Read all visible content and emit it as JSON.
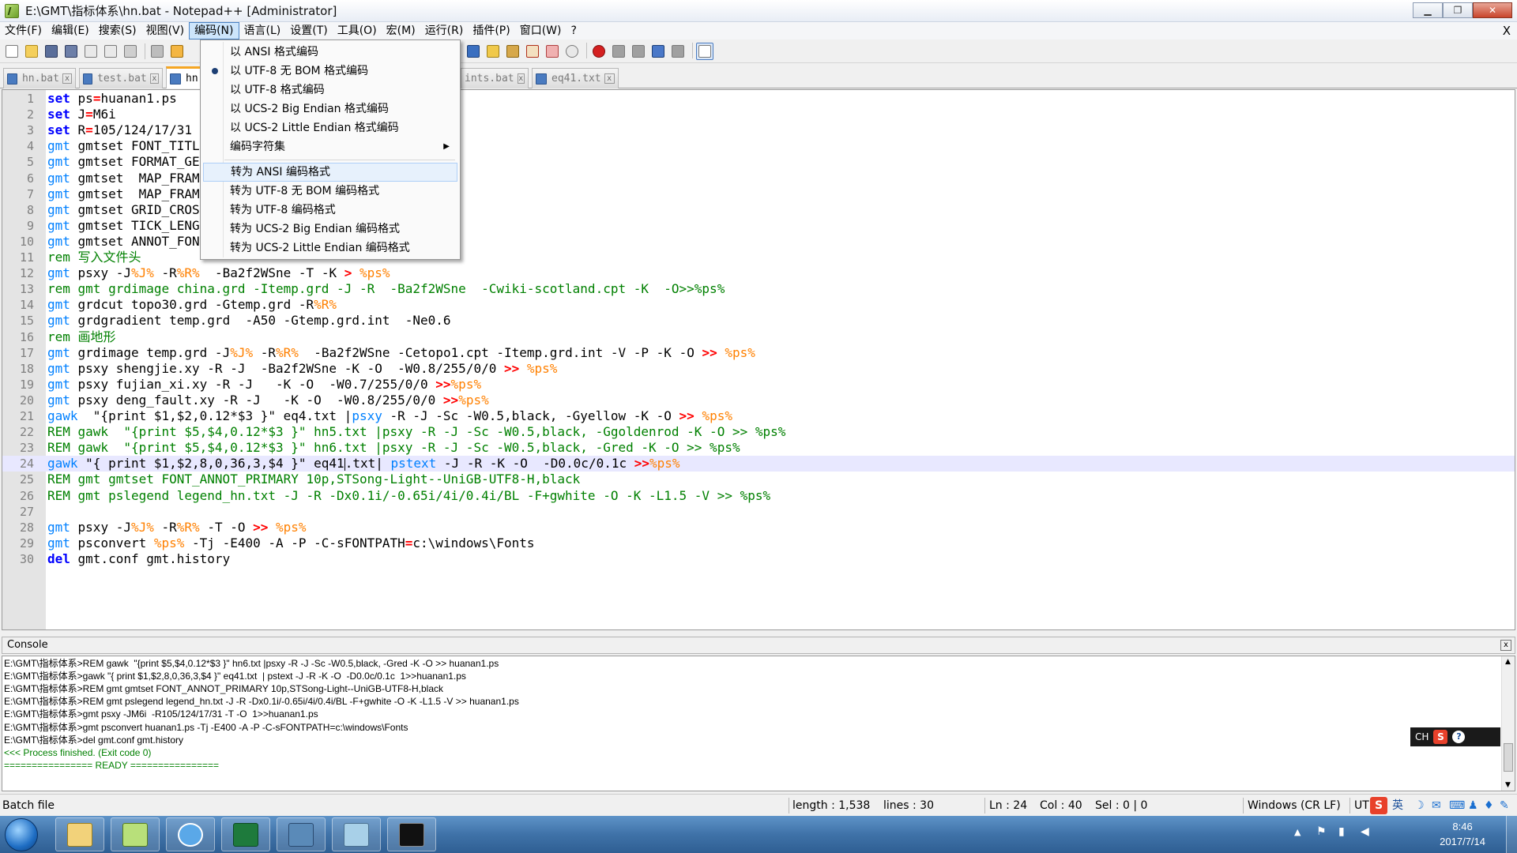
{
  "window": {
    "title": "E:\\GMT\\指标体系\\hn.bat - Notepad++ [Administrator]",
    "minimize_label": "▁",
    "restore_label": "❐",
    "close_label": "✕"
  },
  "menubar": {
    "items": [
      "文件(F)",
      "编辑(E)",
      "搜索(S)",
      "视图(V)",
      "编码(N)",
      "语言(L)",
      "设置(T)",
      "工具(O)",
      "宏(M)",
      "运行(R)",
      "插件(P)",
      "窗口(W)",
      "?"
    ],
    "active_index": 4,
    "close_label": "X"
  },
  "tabs": [
    {
      "label": "hn.bat",
      "active": false
    },
    {
      "label": "test.bat",
      "active": false
    },
    {
      "label": "hn",
      "active": true
    },
    {
      "label": "ints.bat",
      "active": false
    },
    {
      "label": "eq41.txt",
      "active": false
    }
  ],
  "encoding_menu": {
    "items": [
      {
        "label": "以 ANSI 格式编码",
        "checked": false
      },
      {
        "label": "以 UTF-8 无 BOM 格式编码",
        "checked": true
      },
      {
        "label": "以 UTF-8 格式编码",
        "checked": false
      },
      {
        "label": "以 UCS-2 Big Endian 格式编码",
        "checked": false
      },
      {
        "label": "以 UCS-2 Little Endian 格式编码",
        "checked": false
      },
      {
        "label": "编码字符集",
        "submenu": true
      },
      {
        "label": "转为 ANSI 编码格式",
        "hover": true
      },
      {
        "label": "转为 UTF-8 无 BOM 编码格式"
      },
      {
        "label": "转为 UTF-8 编码格式"
      },
      {
        "label": "转为 UCS-2 Big Endian 编码格式"
      },
      {
        "label": "转为 UCS-2 Little Endian 编码格式"
      }
    ],
    "submenu_arrow": "▶"
  },
  "editor": {
    "current_line": 24,
    "lines": [
      [
        [
          "kw",
          "set"
        ],
        [
          "plain",
          " ps"
        ],
        [
          "op",
          "="
        ],
        [
          "plain",
          "huanan1.ps"
        ]
      ],
      [
        [
          "kw",
          "set"
        ],
        [
          "plain",
          " J"
        ],
        [
          "op",
          "="
        ],
        [
          "plain",
          "M6i"
        ]
      ],
      [
        [
          "kw",
          "set"
        ],
        [
          "plain",
          " R"
        ],
        [
          "op",
          "="
        ],
        [
          "plain",
          "105/124/17/31"
        ]
      ],
      [
        [
          "fn",
          "gmt"
        ],
        [
          "plain",
          " gmtset FONT_TITLE"
        ]
      ],
      [
        [
          "fn",
          "gmt"
        ],
        [
          "plain",
          " gmtset FORMAT_GEO"
        ]
      ],
      [
        [
          "fn",
          "gmt"
        ],
        [
          "plain",
          " gmtset  MAP_FRAME"
        ]
      ],
      [
        [
          "fn",
          "gmt"
        ],
        [
          "plain",
          " gmtset  MAP_FRAME"
        ]
      ],
      [
        [
          "fn",
          "gmt"
        ],
        [
          "plain",
          " gmtset GRID_CROSS"
        ]
      ],
      [
        [
          "fn",
          "gmt"
        ],
        [
          "plain",
          " gmtset TICK_LENGTH"
        ]
      ],
      [
        [
          "fn",
          "gmt"
        ],
        [
          "plain",
          " gmtset ANNOT_FONT"
        ]
      ],
      [
        [
          "cm",
          "rem 写入文件头"
        ]
      ],
      [
        [
          "fn",
          "gmt"
        ],
        [
          "plain",
          " psxy -J"
        ],
        [
          "vr",
          "%J%"
        ],
        [
          "plain",
          " -R"
        ],
        [
          "vr",
          "%R%"
        ],
        [
          "plain",
          "  -Ba2f2WSne -T -K "
        ],
        [
          "op",
          ">"
        ],
        [
          "plain",
          " "
        ],
        [
          "vr",
          "%ps%"
        ]
      ],
      [
        [
          "cm",
          "rem gmt grdimage china.grd -Itemp.grd -J -R  -Ba2f2WSne  -Cwiki-scotland.cpt -K  -O>>%ps%"
        ]
      ],
      [
        [
          "fn",
          "gmt"
        ],
        [
          "plain",
          " grdcut topo30.grd -Gtemp.grd -R"
        ],
        [
          "vr",
          "%R%"
        ]
      ],
      [
        [
          "fn",
          "gmt"
        ],
        [
          "plain",
          " grdgradient temp.grd  -A50 -Gtemp.grd.int  -Ne0.6"
        ]
      ],
      [
        [
          "cm",
          "rem 画地形"
        ]
      ],
      [
        [
          "fn",
          "gmt"
        ],
        [
          "plain",
          " grdimage temp.grd -J"
        ],
        [
          "vr",
          "%J%"
        ],
        [
          "plain",
          " -R"
        ],
        [
          "vr",
          "%R%"
        ],
        [
          "plain",
          "  -Ba2f2WSne -Cetopo1.cpt -Itemp.grd.int -V -P -K -O "
        ],
        [
          "op",
          ">>"
        ],
        [
          "plain",
          " "
        ],
        [
          "vr",
          "%ps%"
        ]
      ],
      [
        [
          "fn",
          "gmt"
        ],
        [
          "plain",
          " psxy shengjie.xy -R -J  -Ba2f2WSne -K -O  -W0.8/255/0/0 "
        ],
        [
          "op",
          ">>"
        ],
        [
          "plain",
          " "
        ],
        [
          "vr",
          "%ps%"
        ]
      ],
      [
        [
          "fn",
          "gmt"
        ],
        [
          "plain",
          " psxy fujian_xi.xy -R -J   -K -O  -W0.7/255/0/0 "
        ],
        [
          "op",
          ">>"
        ],
        [
          "vr",
          "%ps%"
        ]
      ],
      [
        [
          "fn",
          "gmt"
        ],
        [
          "plain",
          " psxy deng_fault.xy -R -J   -K -O  -W0.8/255/0/0 "
        ],
        [
          "op",
          ">>"
        ],
        [
          "vr",
          "%ps%"
        ]
      ],
      [
        [
          "fn",
          "gawk"
        ],
        [
          "plain",
          "  \"{print $1,$2,0.12*$3 }\" eq4.txt |"
        ],
        [
          "fn",
          "psxy"
        ],
        [
          "plain",
          " -R -J -Sc -W0.5,black, -Gyellow -K -O "
        ],
        [
          "op",
          ">>"
        ],
        [
          "plain",
          " "
        ],
        [
          "vr",
          "%ps%"
        ]
      ],
      [
        [
          "cm",
          "REM gawk  \"{print $5,$4,0.12*$3 }\" hn5.txt |psxy -R -J -Sc -W0.5,black, -Ggoldenrod -K -O >> %ps%"
        ]
      ],
      [
        [
          "cm",
          "REM gawk  \"{print $5,$4,0.12*$3 }\" hn6.txt |psxy -R -J -Sc -W0.5,black, -Gred -K -O >> %ps%"
        ]
      ],
      [
        [
          "fn",
          "gawk"
        ],
        [
          "plain",
          " \"{ print $1,$2,8,0,36,3,$4 }\" eq41"
        ],
        [
          "caret",
          ""
        ],
        [
          "plain",
          ".txt| "
        ],
        [
          "fn",
          "pstext"
        ],
        [
          "plain",
          " -J -R -K -O  -D0.0c/0.1c "
        ],
        [
          "op",
          ">>"
        ],
        [
          "vr",
          "%ps%"
        ]
      ],
      [
        [
          "cm",
          "REM gmt gmtset FONT_ANNOT_PRIMARY 10p,STSong-Light--UniGB-UTF8-H,black"
        ]
      ],
      [
        [
          "cm",
          "REM gmt pslegend legend_hn.txt -J -R -Dx0.1i/-0.65i/4i/0.4i/BL -F+gwhite -O -K -L1.5 -V >> %ps%"
        ]
      ],
      [],
      [
        [
          "fn",
          "gmt"
        ],
        [
          "plain",
          " psxy -J"
        ],
        [
          "vr",
          "%J%"
        ],
        [
          "plain",
          " -R"
        ],
        [
          "vr",
          "%R%"
        ],
        [
          "plain",
          " -T -O "
        ],
        [
          "op",
          ">>"
        ],
        [
          "plain",
          " "
        ],
        [
          "vr",
          "%ps%"
        ]
      ],
      [
        [
          "fn",
          "gmt"
        ],
        [
          "plain",
          " psconvert "
        ],
        [
          "vr",
          "%ps%"
        ],
        [
          "plain",
          " -Tj -E400 -A -P -C-sFONTPATH"
        ],
        [
          "op",
          "="
        ],
        [
          "plain",
          "c:\\windows\\Fonts"
        ]
      ],
      [
        [
          "kw",
          "del"
        ],
        [
          "plain",
          " gmt.conf gmt.history"
        ]
      ]
    ]
  },
  "console": {
    "title": "Console",
    "close_label": "x",
    "lines": [
      {
        "text": "E:\\GMT\\指标体系>REM gawk  \"{print $5,$4,0.12*$3 }\" hn6.txt |psxy -R -J -Sc -W0.5,black, -Gred -K -O >> huanan1.ps",
        "green": false
      },
      {
        "text": "E:\\GMT\\指标体系>gawk \"{ print $1,$2,8,0,36,3,$4 }\" eq41.txt  | pstext -J -R -K -O  -D0.0c/0.1c  1>>huanan1.ps",
        "green": false
      },
      {
        "text": "E:\\GMT\\指标体系>REM gmt gmtset FONT_ANNOT_PRIMARY 10p,STSong-Light--UniGB-UTF8-H,black",
        "green": false
      },
      {
        "text": "E:\\GMT\\指标体系>REM gmt pslegend legend_hn.txt -J -R -Dx0.1i/-0.65i/4i/0.4i/BL -F+gwhite -O -K -L1.5 -V >> huanan1.ps",
        "green": false
      },
      {
        "text": "E:\\GMT\\指标体系>gmt psxy -JM6i  -R105/124/17/31 -T -O  1>>huanan1.ps",
        "green": false
      },
      {
        "text": "E:\\GMT\\指标体系>gmt psconvert huanan1.ps -Tj -E400 -A -P -C-sFONTPATH=c:\\windows\\Fonts",
        "green": false
      },
      {
        "text": "E:\\GMT\\指标体系>del gmt.conf gmt.history",
        "green": false
      },
      {
        "text": "<<< Process finished. (Exit code 0)",
        "green": true
      },
      {
        "text": "================ READY ================",
        "green": true
      }
    ],
    "ime": {
      "lang": "CH",
      "logo": "S",
      "help": "?"
    }
  },
  "statusbar": {
    "filetype": "Batch file",
    "length": "length : 1,538",
    "lines": "lines : 30",
    "ln": "Ln : 24",
    "col": "Col : 40",
    "sel": "Sel : 0 | 0",
    "eol": "Windows (CR LF)",
    "enc": "UT",
    "ime_mode": "英"
  },
  "taskbar": {
    "time": "8:46",
    "date": "2017/7/14"
  }
}
